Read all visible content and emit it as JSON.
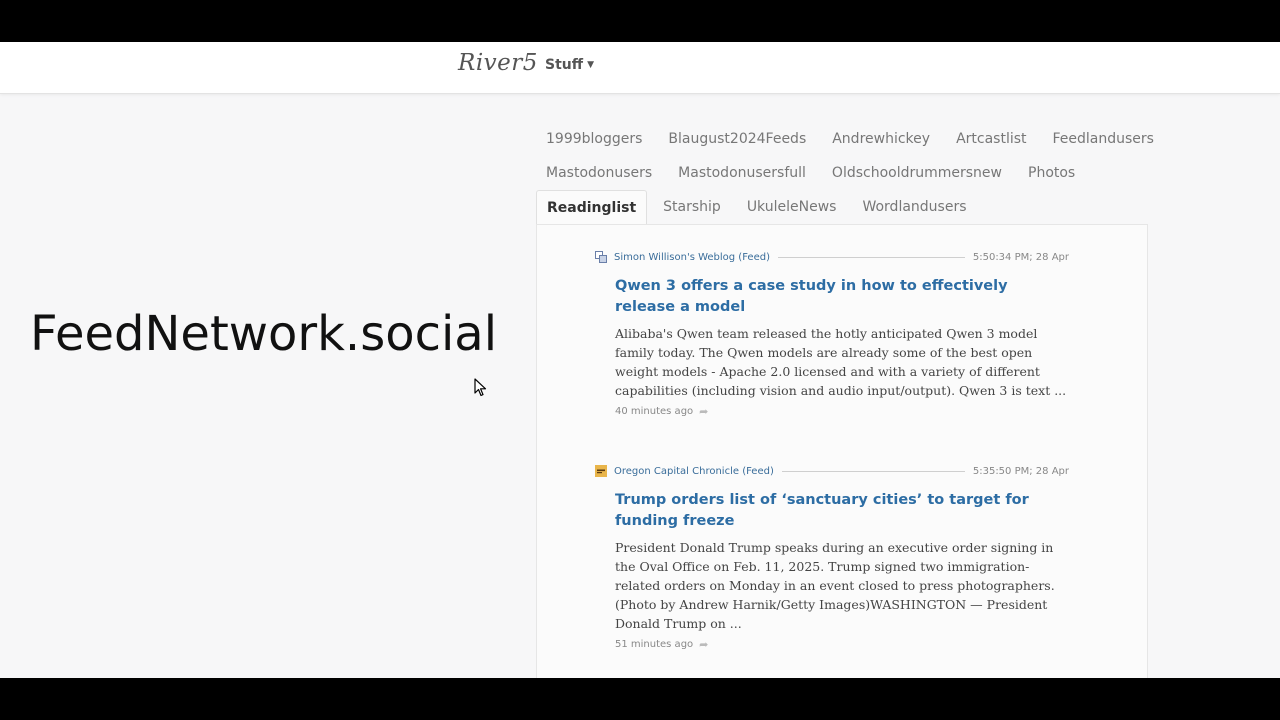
{
  "app": {
    "brand": "River5",
    "menu_label": "Stuff",
    "hero_text": "FeedNetwork.social"
  },
  "tabs": {
    "row1": [
      "1999bloggers",
      "Blaugust2024Feeds",
      "Andrewhickey",
      "Artcastlist",
      "Feedlandusers"
    ],
    "row2": [
      "Mastodonusers",
      "Mastodonusersfull",
      "Oldschooldrummersnew",
      "Photos"
    ],
    "row3": [
      "Readinglist",
      "Starship",
      "UkuleleNews",
      "Wordlandusers"
    ],
    "active": "Readinglist"
  },
  "items": [
    {
      "feed": "Simon Willison's Weblog (Feed)",
      "time": "5:50:34 PM; 28 Apr",
      "title": "Qwen 3 offers a case study in how to effectively release a model",
      "summary": "Alibaba's Qwen team released the hotly anticipated Qwen 3 model family today. The Qwen models are already some of the best open weight models - Apache 2.0 licensed and with a variety of different capabilities (including vision and audio input/output). Qwen 3 is text ...",
      "ago": "40 minutes ago",
      "icon": "blog-feed-icon"
    },
    {
      "feed": "Oregon Capital Chronicle (Feed)",
      "time": "5:35:50 PM; 28 Apr",
      "title": "Trump orders list of ‘sanctuary cities’ to target for funding freeze",
      "summary": "President Donald Trump speaks during an executive order signing in the Oval Office on Feb. 11, 2025. Trump signed two immigration-related orders on Monday in an event closed to press photographers. (Photo by Andrew Harnik/Getty Images)WASHINGTON — President Donald Trump on ...",
      "ago": "51 minutes ago",
      "icon": "news-feed-icon"
    }
  ],
  "colors": {
    "link": "#2d6da4",
    "feed_name": "#3a6d9a",
    "background": "#f7f7f8"
  }
}
